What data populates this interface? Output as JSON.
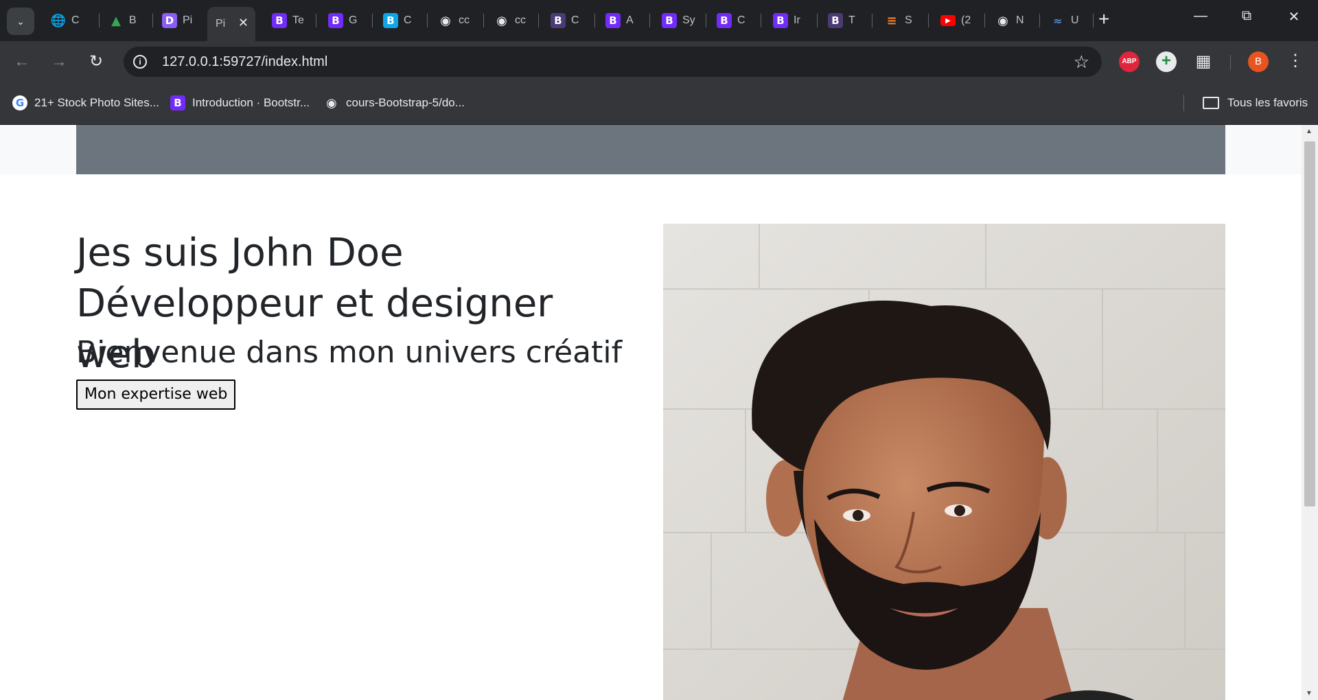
{
  "tabs": [
    {
      "label": "C",
      "icon": "globe-icon"
    },
    {
      "label": "B",
      "icon": "chart-icon"
    },
    {
      "label": "Pi",
      "icon": "p-icon"
    },
    {
      "label": "Pi",
      "icon": "page-icon",
      "active": true
    },
    {
      "label": "Te",
      "icon": "bootstrap-icon"
    },
    {
      "label": "G",
      "icon": "bootstrap-icon"
    },
    {
      "label": "C",
      "icon": "bootstrap-blue-icon"
    },
    {
      "label": "cc",
      "icon": "github-icon"
    },
    {
      "label": "cc",
      "icon": "github-icon"
    },
    {
      "label": "C",
      "icon": "bootstrap-dark-icon"
    },
    {
      "label": "A",
      "icon": "bootstrap-icon"
    },
    {
      "label": "Sy",
      "icon": "bootstrap-icon"
    },
    {
      "label": "C",
      "icon": "bootstrap-icon"
    },
    {
      "label": "Ir",
      "icon": "bootstrap-icon"
    },
    {
      "label": "T",
      "icon": "bootstrap-dark-icon"
    },
    {
      "label": "S",
      "icon": "stackoverflow-icon"
    },
    {
      "label": "(2",
      "icon": "youtube-icon"
    },
    {
      "label": "N",
      "icon": "chrome-icon"
    },
    {
      "label": "U",
      "icon": "wave-icon"
    }
  ],
  "toolbar": {
    "url": "127.0.0.1:59727/index.html"
  },
  "avatar_initial": "B",
  "bookmarks": [
    {
      "label": "21+ Stock Photo Sites...",
      "icon": "google-icon"
    },
    {
      "label": "Introduction · Bootstr...",
      "icon": "bootstrap-icon"
    },
    {
      "label": "cours-Bootstrap-5/do...",
      "icon": "github-icon"
    }
  ],
  "bookmarks_folder": "Tous les favoris",
  "page": {
    "heading_line1": "Jes suis John Doe",
    "heading_line2": "Développeur et designer web",
    "subheading": "Bienvenue dans mon univers créatif",
    "button_label": "Mon expertise web"
  },
  "colors": {
    "navbar": "#6c757d",
    "text": "#212529",
    "chrome_dark": "#202124",
    "chrome_toolbar": "#35363a"
  }
}
